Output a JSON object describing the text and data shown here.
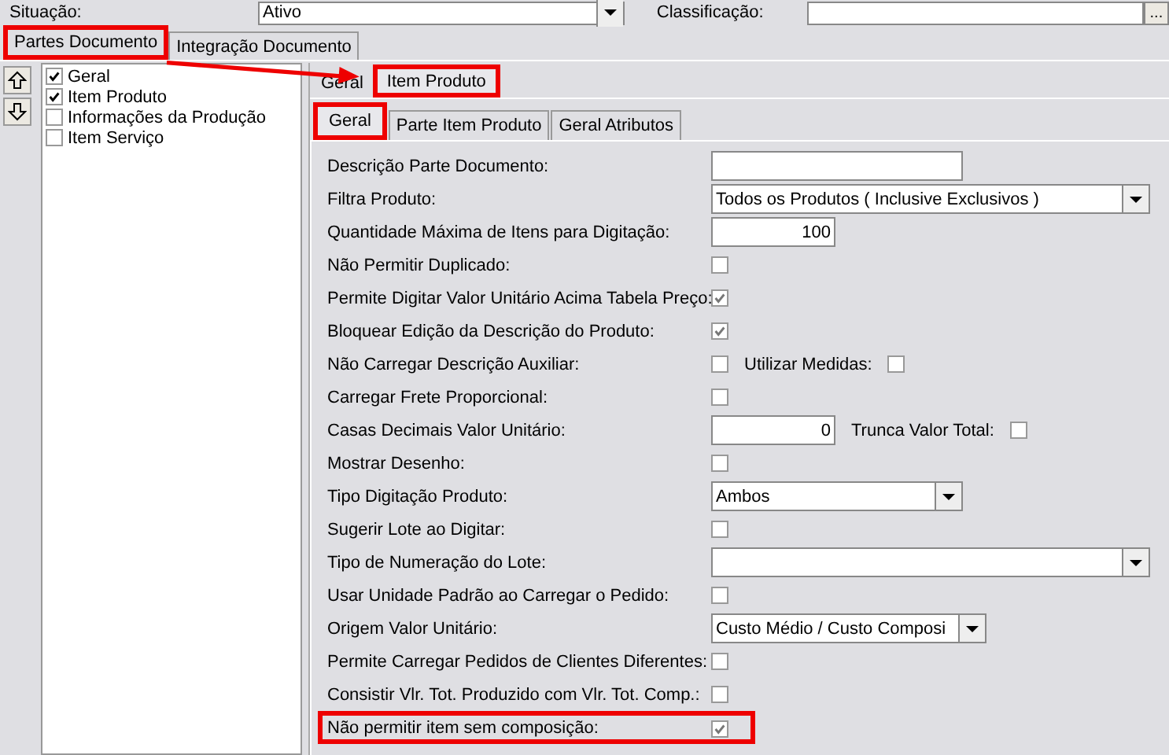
{
  "top_fields": [
    {
      "label": "Situação:",
      "value": "Ativo",
      "kind": "select"
    },
    {
      "label": "Classificação:",
      "kind": "lookup",
      "button": "..."
    }
  ],
  "tabs": [
    {
      "label": "Partes Documento",
      "selected": true,
      "highlighted": true
    },
    {
      "label": "Integração Documento",
      "selected": false,
      "highlighted": false
    }
  ],
  "parts_list": [
    {
      "label": "Geral",
      "checked": true
    },
    {
      "label": "Item Produto",
      "checked": true
    },
    {
      "label": "Informações da Produção",
      "checked": false
    },
    {
      "label": "Item Serviço",
      "checked": false
    }
  ],
  "part_tabs": [
    {
      "label": "Geral",
      "selected": false,
      "highlighted": false
    },
    {
      "label": "Item Produto",
      "selected": true,
      "highlighted": true
    }
  ],
  "sub_tabs": [
    {
      "label": "Geral",
      "selected": true,
      "highlighted": true
    },
    {
      "label": "Parte Item Produto",
      "selected": false,
      "highlighted": false
    },
    {
      "label": "Geral Atributos",
      "selected": false,
      "highlighted": false
    }
  ],
  "form": [
    {
      "label": "Descrição Parte Documento:",
      "kind": "text"
    },
    {
      "label": "Filtra Produto:",
      "kind": "select",
      "value": "Todos os Produtos ( Inclusive Exclusivos )"
    },
    {
      "label": "Quantidade Máxima de Itens para Digitação:",
      "kind": "number",
      "value": "100"
    },
    {
      "label": "Não Permitir Duplicado:",
      "kind": "checkbox",
      "checked": false
    },
    {
      "label": "Permite Digitar Valor Unitário Acima Tabela Preço:",
      "kind": "checkbox",
      "checked": true
    },
    {
      "label": "Bloquear Edição da Descrição do Produto:",
      "kind": "checkbox",
      "checked": true
    },
    {
      "label": "Não Carregar Descrição Auxiliar:",
      "kind": "checkbox",
      "checked": false,
      "extra": {
        "label": "Utilizar Medidas:",
        "checked": false
      }
    },
    {
      "label": "Carregar Frete Proporcional:",
      "kind": "checkbox",
      "checked": false
    },
    {
      "label": "Casas Decimais Valor Unitário:",
      "kind": "number",
      "value": "0",
      "extra": {
        "label": "Trunca Valor Total:",
        "checked": false
      }
    },
    {
      "label": "Mostrar Desenho:",
      "kind": "checkbox",
      "checked": false
    },
    {
      "label": "Tipo Digitação Produto:",
      "kind": "select",
      "value": "Ambos"
    },
    {
      "label": "Sugerir Lote ao Digitar:",
      "kind": "checkbox",
      "checked": false
    },
    {
      "label": "Tipo de Numeração do Lote:",
      "kind": "select"
    },
    {
      "label": "Usar Unidade Padrão ao Carregar o Pedido:",
      "kind": "checkbox",
      "checked": false
    },
    {
      "label": "Origem Valor Unitário:",
      "kind": "select",
      "value": "Custo Médio / Custo Composi"
    },
    {
      "label": "Permite Carregar Pedidos de Clientes Diferentes:",
      "kind": "checkbox",
      "checked": false
    },
    {
      "label": "Consistir Vlr. Tot. Produzido com Vlr. Tot. Comp.:",
      "kind": "checkbox",
      "checked": false
    },
    {
      "label": "Não permitir item sem composição:",
      "kind": "checkbox",
      "checked": true,
      "highlighted": true
    }
  ]
}
